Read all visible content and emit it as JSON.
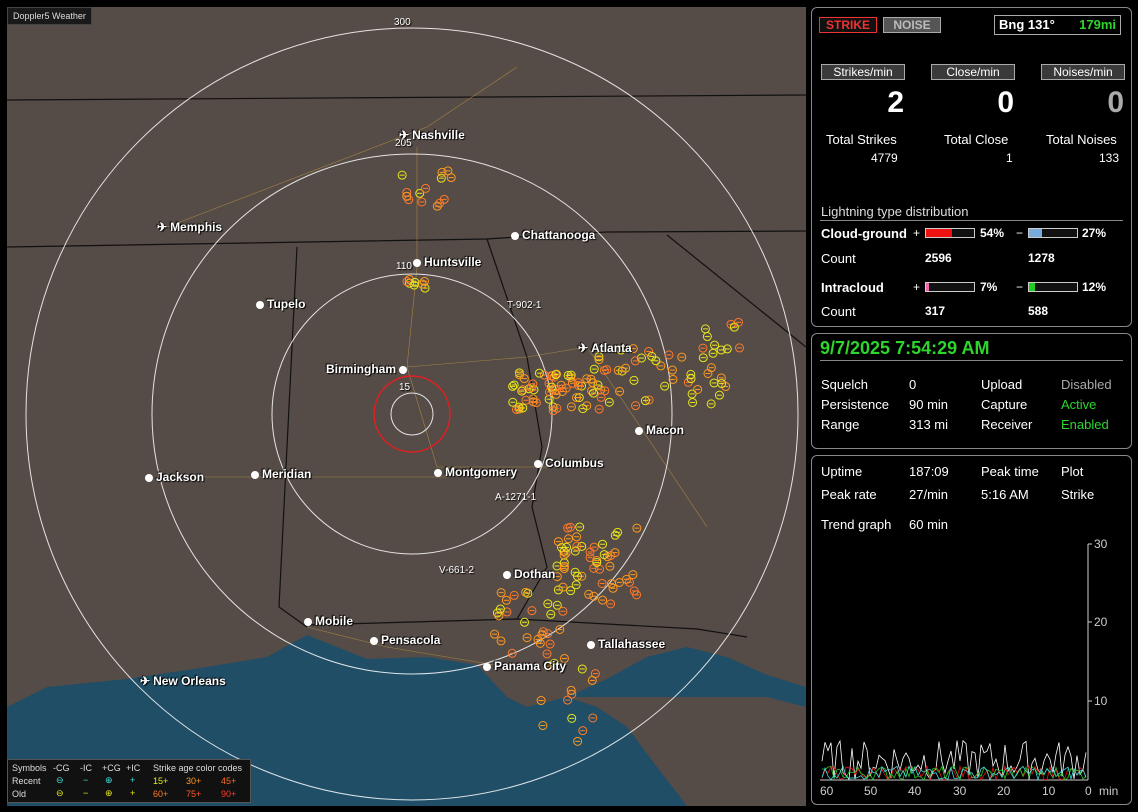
{
  "map": {
    "title": "Doppler5 Weather",
    "range_rings": [
      "15",
      "110",
      "205",
      "300"
    ],
    "cities": [
      {
        "name": "Nashville",
        "icon": "airport-icon"
      },
      {
        "name": "Memphis",
        "icon": "airport-icon"
      },
      {
        "name": "Chattanooga",
        "icon": "dot-icon"
      },
      {
        "name": "Huntsville",
        "icon": "dot-icon"
      },
      {
        "name": "Tupelo",
        "icon": "dot-icon"
      },
      {
        "name": "Atlanta",
        "icon": "airport-icon"
      },
      {
        "name": "Birmingham",
        "icon": "dot-icon"
      },
      {
        "name": "Macon",
        "icon": "dot-icon"
      },
      {
        "name": "Columbus",
        "icon": "dot-icon"
      },
      {
        "name": "Montgomery",
        "icon": "dot-icon"
      },
      {
        "name": "Jackson",
        "icon": "dot-icon"
      },
      {
        "name": "Meridian",
        "icon": "dot-icon"
      },
      {
        "name": "Dothan",
        "icon": "dot-icon"
      },
      {
        "name": "Mobile",
        "icon": "dot-icon"
      },
      {
        "name": "Pensacola",
        "icon": "dot-icon"
      },
      {
        "name": "Tallahassee",
        "icon": "dot-icon"
      },
      {
        "name": "Panama City",
        "icon": "dot-icon"
      },
      {
        "name": "New Orleans",
        "icon": "airport-icon"
      }
    ],
    "storm_labels": [
      "T-902-1",
      "A-1271-1",
      "V-661-2"
    ],
    "colors": {
      "land": "#554b47",
      "water": "#1f4e66",
      "ring": "#ffffff",
      "close_ring": "#e02020",
      "recent_strike": "#ff9a1f",
      "old_strike": "#e8e81a"
    }
  },
  "legend": {
    "symbols_label": "Symbols",
    "headers": [
      "-CG",
      "-IC",
      "+CG",
      "+IC"
    ],
    "recent_label": "Recent",
    "old_label": "Old",
    "age_title": "Strike age color codes",
    "age_recent": [
      "15+",
      "30+",
      "45+"
    ],
    "age_old": [
      "60+",
      "75+",
      "90+"
    ]
  },
  "panel_top": {
    "strike_btn": "STRIKE",
    "noise_btn": "NOISE",
    "bearing_label": "Bng 131°",
    "distance_label": "179mi",
    "strikes_per_min_label": "Strikes/min",
    "close_per_min_label": "Close/min",
    "noises_per_min_label": "Noises/min",
    "strikes_per_min": "2",
    "close_per_min": "0",
    "noises_per_min": "0",
    "total_strikes_label": "Total Strikes",
    "total_close_label": "Total Close",
    "total_noises_label": "Total Noises",
    "total_strikes": "4779",
    "total_close": "1",
    "total_noises": "133",
    "dist_title": "Lightning type distribution",
    "cg_label": "Cloud-ground",
    "ic_label": "Intracloud",
    "count_label": "Count",
    "plus": "+",
    "minus": "−",
    "cg_pos_pct": "54%",
    "cg_neg_pct": "27%",
    "cg_pos_count": "2596",
    "cg_neg_count": "1278",
    "ic_pos_pct": "7%",
    "ic_neg_pct": "12%",
    "ic_pos_count": "317",
    "ic_neg_count": "588",
    "bar_levels": {
      "cg_pos": 0.54,
      "cg_neg": 0.27,
      "ic_pos": 0.07,
      "ic_neg": 0.12
    }
  },
  "panel_mid": {
    "datetime": "9/7/2025 7:54:29 AM",
    "squelch_label": "Squelch",
    "squelch": "0",
    "persistence_label": "Persistence",
    "persistence": "90 min",
    "range_label": "Range",
    "range": "313 mi",
    "upload_label": "Upload",
    "upload": "Disabled",
    "capture_label": "Capture",
    "capture": "Active",
    "receiver_label": "Receiver",
    "receiver": "Enabled"
  },
  "panel_bottom": {
    "uptime_label": "Uptime",
    "uptime": "187:09",
    "peak_time_label": "Peak time",
    "plot_label": "Plot",
    "peak_rate_label": "Peak rate",
    "peak_rate": "27/min",
    "peak_time": "5:16 AM",
    "plot": "Strike",
    "trend_label": "Trend graph",
    "trend": "60 min",
    "y_ticks": [
      "30",
      "20",
      "10"
    ],
    "x_ticks": [
      "60",
      "50",
      "40",
      "30",
      "20",
      "10",
      "0"
    ],
    "x_unit": "min"
  }
}
